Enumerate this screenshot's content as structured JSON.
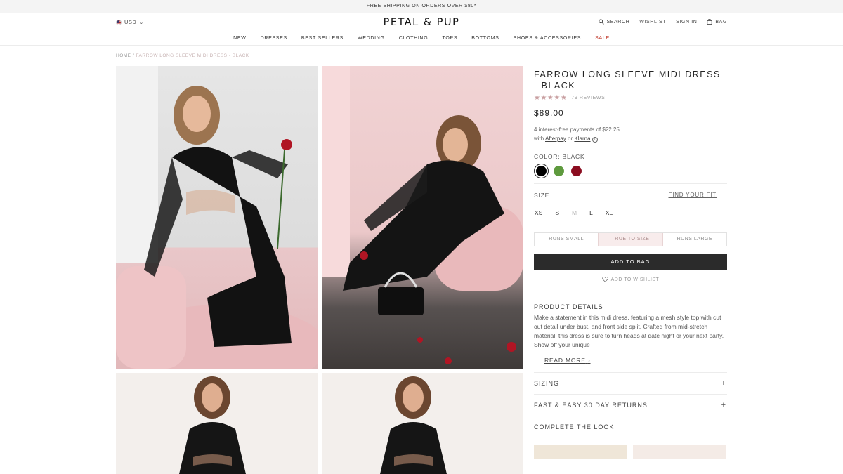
{
  "promo": "FREE SHIPPING ON ORDERS OVER $80*",
  "header": {
    "currency": "USD",
    "logo": "PETAL & PUP",
    "search": "SEARCH",
    "wishlist": "WISHLIST",
    "signin": "SIGN IN",
    "bag": "BAG"
  },
  "nav": [
    "NEW",
    "DRESSES",
    "BEST SELLERS",
    "WEDDING",
    "CLOTHING",
    "TOPS",
    "BOTTOMS",
    "SHOES & ACCESSORIES",
    "SALE"
  ],
  "breadcrumb": {
    "home": "HOME",
    "sep": "/",
    "current": "FARROW LONG SLEEVE MIDI DRESS - BLACK"
  },
  "product": {
    "title": "FARROW LONG SLEEVE MIDI DRESS - BLACK",
    "stars": "★★★★★",
    "reviews": "79 REVIEWS",
    "price": "$89.00",
    "afterpay_line1": "4 interest-free payments of $22.25",
    "afterpay_with": "with",
    "afterpay_link": "Afterpay",
    "afterpay_or": "or",
    "klarna_link": "Klarna",
    "info": "i",
    "color_label": "COLOR: BLACK",
    "swatch_colors": [
      "#000000",
      "#5e9a3e",
      "#8b0d20"
    ],
    "size_label": "SIZE",
    "find_fit": "FIND YOUR FIT",
    "sizes": [
      "XS",
      "S",
      "M",
      "L",
      "XL"
    ],
    "fit": [
      "RUNS SMALL",
      "TRUE TO SIZE",
      "RUNS LARGE"
    ],
    "add_to_bag": "ADD TO BAG",
    "add_to_wishlist": "ADD TO WISHLIST",
    "details_heading": "PRODUCT DETAILS",
    "details_text": "Make a statement in this midi dress, featuring a mesh style top with cut out detail under bust, and front side split. Crafted from mid-stretch material, this dress is sure to turn heads at date night or your next party. Show off your unique",
    "read_more": "READ MORE",
    "accordions": [
      "SIZING",
      "FAST & EASY 30 DAY RETURNS"
    ],
    "plus": "+",
    "complete_look": "COMPLETE THE LOOK"
  },
  "colors": {
    "accent_sale": "#c0392b",
    "button": "#2b2b2b",
    "stars": "#c9a0a2"
  }
}
